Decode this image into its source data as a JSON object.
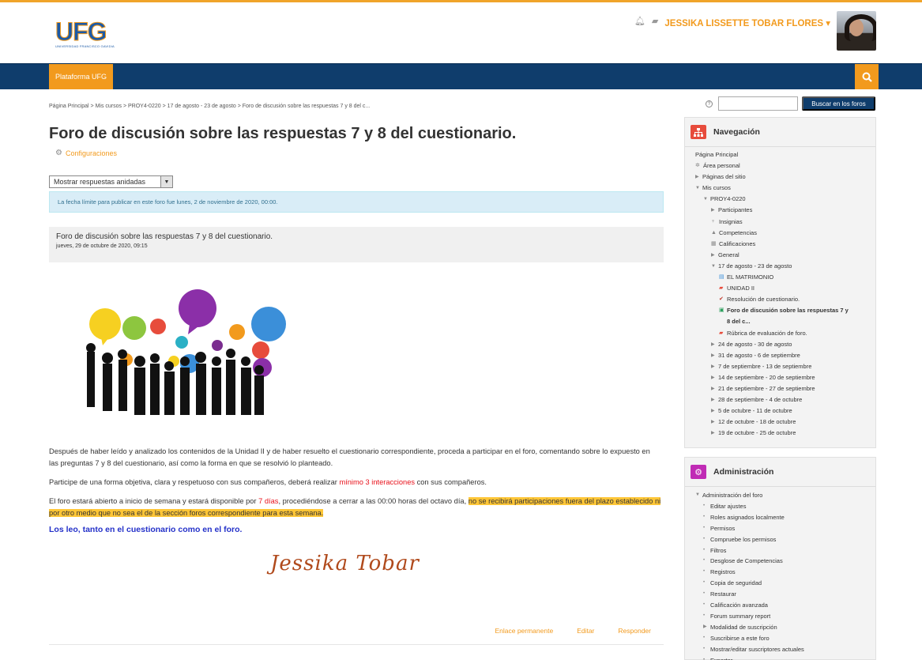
{
  "header": {
    "logo_text": "UFG",
    "logo_subtitle": "UNIVERSIDAD FRANCISCO GAVIDIA",
    "user_name": "JESSIKA LISSETTE TOBAR FLORES"
  },
  "navbar": {
    "item": "Plataforma UFG"
  },
  "breadcrumb": "Página Principal  >  Mis cursos  >  PROY4-0220  >  17 de agosto - 23 de agosto  >  Foro de discusión sobre las respuestas 7 y 8 del c...",
  "page": {
    "title": "Foro de discusión sobre las respuestas 7 y 8 del cuestionario.",
    "settings_link": "Configuraciones",
    "display_mode": "Mostrar respuestas anidadas",
    "notice": "La fecha límite para publicar en este foro fue lunes, 2 de noviembre de 2020, 00:00."
  },
  "post": {
    "subject": "Foro de discusión sobre las respuestas 7 y 8 del cuestionario.",
    "date": "jueves, 29 de octubre de 2020, 09:15",
    "p1": "Después de haber leído y analizado los contenidos de la Unidad II y de haber resuelto el cuestionario correspondiente, proceda a participar en el foro, comentando sobre lo expuesto en las preguntas 7 y 8 del cuestionario, así como la forma en que se resolvió lo planteado.",
    "p2_a": "Participe de una forma objetiva, clara y respetuoso con sus compañeros, deberá realizar ",
    "p2_red": "mínimo 3 interacciones",
    "p2_b": " con sus compañeros.",
    "p3_a": "El foro estará abierto a inicio de semana y estará disponible por ",
    "p3_red": "7 días",
    "p3_b": ", procediéndose a cerrar a las 00:00 horas del octavo día, ",
    "p3_hl": "no se recibirá participaciones fuera del plazo establecido ni por otro medio que no sea el de la sección foros correspondiente para esta semana.",
    "closing": "Los leo, tanto en el cuestionario como en el foro.",
    "signature": "Jessika Tobar",
    "actions": [
      "Enlace permanente",
      "Editar",
      "Responder"
    ]
  },
  "forum_search": {
    "button": "Buscar en los foros"
  },
  "navigation": {
    "title": "Navegación",
    "items": [
      {
        "label": "Página Principal",
        "indent": 0,
        "twisty": "",
        "icon": ""
      },
      {
        "label": "Área personal",
        "indent": 0,
        "twisty": "",
        "icon": "✲"
      },
      {
        "label": "Páginas del sitio",
        "indent": 0,
        "twisty": "▶",
        "icon": ""
      },
      {
        "label": "Mis cursos",
        "indent": 0,
        "twisty": "▼",
        "icon": ""
      },
      {
        "label": "PROY4-0220",
        "indent": 1,
        "twisty": "▼",
        "icon": ""
      },
      {
        "label": "Participantes",
        "indent": 2,
        "twisty": "▶",
        "icon": ""
      },
      {
        "label": "Insignias",
        "indent": 2,
        "twisty": "",
        "icon": "♆"
      },
      {
        "label": "Competencias",
        "indent": 2,
        "twisty": "",
        "icon": "▲"
      },
      {
        "label": "Calificaciones",
        "indent": 2,
        "twisty": "",
        "icon": "▦"
      },
      {
        "label": "General",
        "indent": 2,
        "twisty": "▶",
        "icon": ""
      },
      {
        "label": "17 de agosto - 23 de agosto",
        "indent": 2,
        "twisty": "▼",
        "icon": ""
      },
      {
        "label": "EL MATRIMONIO",
        "indent": 3,
        "twisty": "",
        "icon": "▤"
      },
      {
        "label": "UNIDAD II",
        "indent": 3,
        "twisty": "",
        "icon": "▰"
      },
      {
        "label": "Resolución de cuestionario.",
        "indent": 3,
        "twisty": "",
        "icon": "✔"
      },
      {
        "label": "Foro de discusión sobre las respuestas 7 y",
        "indent": 3,
        "twisty": "",
        "icon": "▣",
        "bold": true
      },
      {
        "label": "8 del c...",
        "indent": 3,
        "twisty": "",
        "icon": " ",
        "bold": true
      },
      {
        "label": "Rúbrica de evaluación de foro.",
        "indent": 3,
        "twisty": "",
        "icon": "▰"
      },
      {
        "label": "24 de agosto - 30 de agosto",
        "indent": 2,
        "twisty": "▶",
        "icon": ""
      },
      {
        "label": "31 de agosto - 6 de septiembre",
        "indent": 2,
        "twisty": "▶",
        "icon": ""
      },
      {
        "label": "7 de septiembre - 13 de septiembre",
        "indent": 2,
        "twisty": "▶",
        "icon": ""
      },
      {
        "label": "14 de septiembre - 20 de septiembre",
        "indent": 2,
        "twisty": "▶",
        "icon": ""
      },
      {
        "label": "21 de septiembre - 27 de septiembre",
        "indent": 2,
        "twisty": "▶",
        "icon": ""
      },
      {
        "label": "28 de septiembre - 4 de octubre",
        "indent": 2,
        "twisty": "▶",
        "icon": ""
      },
      {
        "label": "5 de octubre - 11 de octubre",
        "indent": 2,
        "twisty": "▶",
        "icon": ""
      },
      {
        "label": "12 de octubre - 18 de octubre",
        "indent": 2,
        "twisty": "▶",
        "icon": ""
      },
      {
        "label": "19 de octubre - 25 de octubre",
        "indent": 2,
        "twisty": "▶",
        "icon": ""
      }
    ]
  },
  "administration": {
    "title": "Administración",
    "items": [
      {
        "label": "Administración del foro",
        "indent": 0,
        "twisty": "▼"
      },
      {
        "label": "Editar ajustes",
        "indent": 1,
        "twisty": "•"
      },
      {
        "label": "Roles asignados localmente",
        "indent": 1,
        "twisty": "•"
      },
      {
        "label": "Permisos",
        "indent": 1,
        "twisty": "•"
      },
      {
        "label": "Compruebe los permisos",
        "indent": 1,
        "twisty": "•"
      },
      {
        "label": "Filtros",
        "indent": 1,
        "twisty": "•"
      },
      {
        "label": "Desglose de Competencias",
        "indent": 1,
        "twisty": "•"
      },
      {
        "label": "Registros",
        "indent": 1,
        "twisty": "•"
      },
      {
        "label": "Copia de seguridad",
        "indent": 1,
        "twisty": "•"
      },
      {
        "label": "Restaurar",
        "indent": 1,
        "twisty": "•"
      },
      {
        "label": "Calificación avanzada",
        "indent": 1,
        "twisty": "•"
      },
      {
        "label": "Forum summary report",
        "indent": 1,
        "twisty": "•"
      },
      {
        "label": "Modalidad de suscripción",
        "indent": 1,
        "twisty": "▶"
      },
      {
        "label": "Suscribirse a este foro",
        "indent": 1,
        "twisty": "•"
      },
      {
        "label": "Mostrar/editar suscriptores actuales",
        "indent": 1,
        "twisty": "•"
      },
      {
        "label": "Exportar",
        "indent": 1,
        "twisty": "•"
      }
    ]
  },
  "colors": {
    "accent": "#f29a1d",
    "navbar": "#0f3d6c",
    "link_red": "#e8101a",
    "highlight": "#ffc637",
    "closing_blue": "#2431c9"
  }
}
